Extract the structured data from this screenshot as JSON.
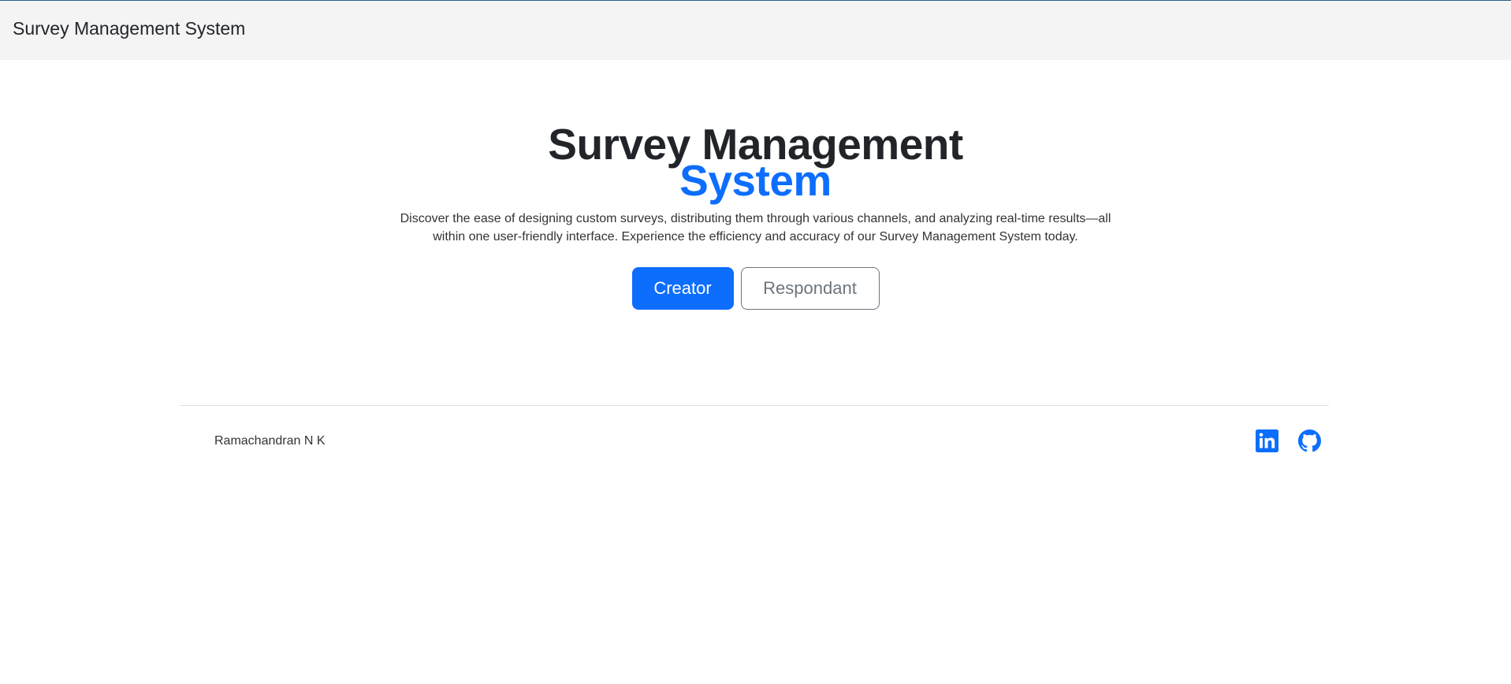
{
  "navbar": {
    "brand": "Survey Management System"
  },
  "hero": {
    "title_line1": "Survey Management",
    "title_line2": "System",
    "description": "Discover the ease of designing custom surveys, distributing them through various channels, and analyzing real-time results—all within one user-friendly interface. Experience the efficiency and accuracy of our Survey Management System today.",
    "buttons": {
      "creator": "Creator",
      "respondant": "Respondant"
    }
  },
  "footer": {
    "author": "Ramachandran N K",
    "icons": [
      "linkedin-icon",
      "github-icon"
    ]
  },
  "colors": {
    "accent": "#0d6efd",
    "navbar_bg": "#f4f4f4",
    "text": "#212529",
    "outline": "#6c757d"
  }
}
